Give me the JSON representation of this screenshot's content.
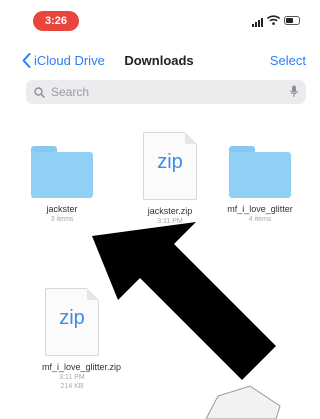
{
  "status_bar": {
    "time": "3:26"
  },
  "nav": {
    "back_label": "iCloud Drive",
    "title": "Downloads",
    "select_label": "Select"
  },
  "search": {
    "placeholder": "Search"
  },
  "files": [
    {
      "name": "jackster",
      "meta": [
        "3 items"
      ],
      "kind": "folder"
    },
    {
      "name": "jackster.zip",
      "meta": [
        "3:11 PM"
      ],
      "kind": "zip",
      "ext": "zip"
    },
    {
      "name": "mf_i_love_glitter",
      "meta": [
        "4 items"
      ],
      "kind": "folder"
    },
    {
      "name": "mf_i_love_glitter.zip",
      "meta": [
        "3:11 PM",
        "214 KB"
      ],
      "kind": "zip",
      "ext": "zip"
    }
  ],
  "colors": {
    "accent": "#2f7cf6",
    "folder": "#8fd0f4",
    "time_pill": "#e8453c",
    "arrow": "#000000"
  }
}
